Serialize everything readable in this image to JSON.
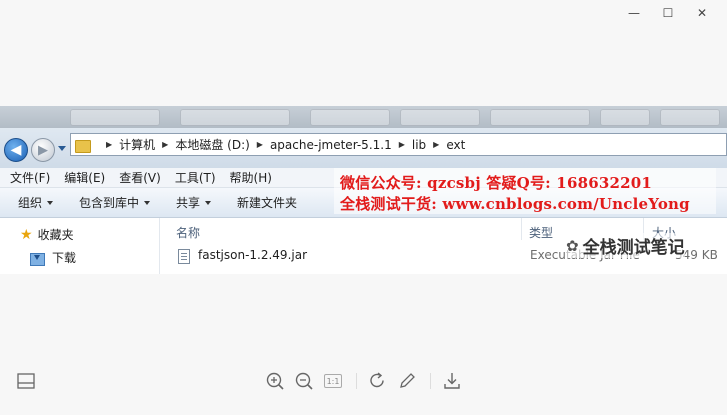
{
  "window": {
    "minimize_glyph": "—",
    "maximize_glyph": "☐",
    "close_glyph": "✕"
  },
  "address_bar": {
    "breadcrumbs": [
      "计算机",
      "本地磁盘 (D:)",
      "apache-jmeter-5.1.1",
      "lib",
      "ext"
    ]
  },
  "menu": {
    "items": [
      "文件(F)",
      "编辑(E)",
      "查看(V)",
      "工具(T)",
      "帮助(H)"
    ]
  },
  "toolbar": {
    "organize": "组织",
    "include_in_library": "包含到库中",
    "share": "共享",
    "new_folder": "新建文件夹"
  },
  "watermark": {
    "line1": "微信公众号: qzcsbj   答疑Q号: 168632201",
    "line2": "全栈测试干货: www.cnblogs.com/UncleYong"
  },
  "nav_pane": {
    "favorites": "收藏夹",
    "downloads": "下载"
  },
  "file_list": {
    "headers": {
      "name": "名称",
      "type": "类型",
      "size": "大小"
    },
    "rows": [
      {
        "name": "fastjson-1.2.49.jar",
        "type": "Executable Jar File",
        "size": "549 KB"
      }
    ]
  },
  "signature": {
    "text": "全栈测试笔记"
  },
  "viewer_toolbar": {
    "icons": [
      "panel-icon",
      "zoom-in-icon",
      "zoom-out-icon",
      "actual-size-icon",
      "rotate-icon",
      "edit-icon",
      "download-icon"
    ],
    "actual_size_label": "1:1"
  }
}
